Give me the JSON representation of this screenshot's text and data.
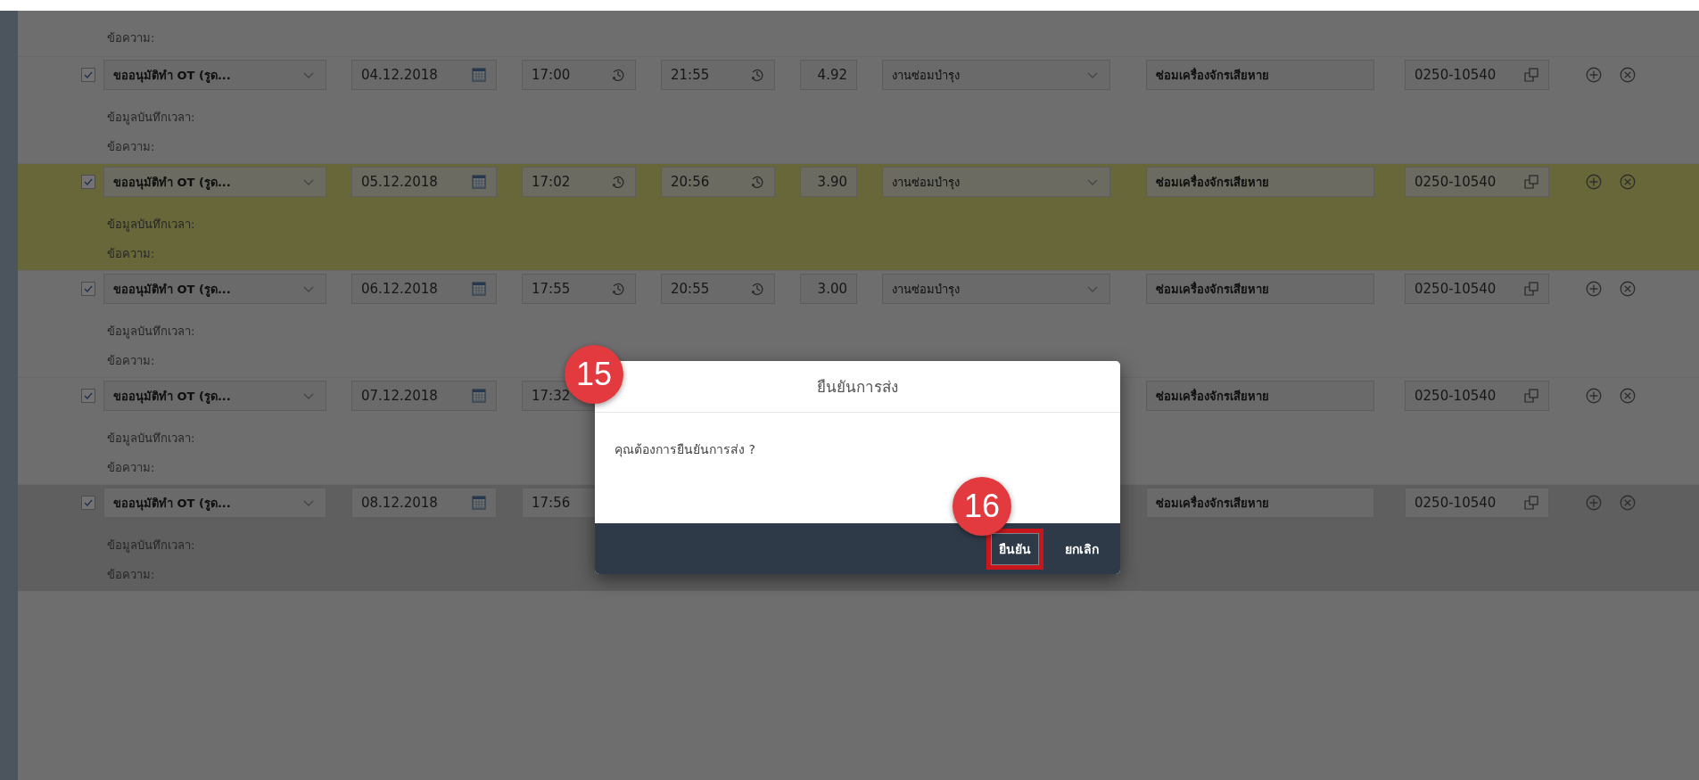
{
  "leading_label": "ข้อความ:",
  "rows": [
    {
      "checked": true,
      "selected": false,
      "hovered": false,
      "type": "ขออนุมัติทำ OT (รูด...",
      "date": "04.12.2018",
      "start": "17:00",
      "end": "21:55",
      "hours": "4.92",
      "category": "งานซ่อมบำรุง",
      "description": "ซ่อมเครื่องจักรเสียหาย",
      "code": "0250-10540",
      "labels": [
        "ข้อมูลบันทึกเวลา:",
        "ข้อความ:"
      ]
    },
    {
      "checked": true,
      "selected": true,
      "hovered": false,
      "type": "ขออนุมัติทำ OT (รูด...",
      "date": "05.12.2018",
      "start": "17:02",
      "end": "20:56",
      "hours": "3.90",
      "category": "งานซ่อมบำรุง",
      "description": "ซ่อมเครื่องจักรเสียหาย",
      "code": "0250-10540",
      "labels": [
        "ข้อมูลบันทึกเวลา:",
        "ข้อความ:"
      ]
    },
    {
      "checked": true,
      "selected": false,
      "hovered": false,
      "type": "ขออนุมัติทำ OT (รูด...",
      "date": "06.12.2018",
      "start": "17:55",
      "end": "20:55",
      "hours": "3.00",
      "category": "งานซ่อมบำรุง",
      "description": "ซ่อมเครื่องจักรเสียหาย",
      "code": "0250-10540",
      "labels": [
        "ข้อมูลบันทึกเวลา:",
        "ข้อความ:"
      ]
    },
    {
      "checked": true,
      "selected": false,
      "hovered": false,
      "type": "ขออนุมัติทำ OT (รูด...",
      "date": "07.12.2018",
      "start": "17:32",
      "description": "ซ่อมเครื่องจักรเสียหาย",
      "code": "0250-10540",
      "labels": [
        "ข้อมูลบันทึกเวลา:",
        "ข้อความ:"
      ]
    },
    {
      "checked": true,
      "selected": false,
      "hovered": true,
      "type": "ขออนุมัติทำ OT (รูด...",
      "date": "08.12.2018",
      "start": "17:56",
      "description": "ซ่อมเครื่องจักรเสียหาย",
      "code": "0250-10540",
      "labels": [
        "ข้อมูลบันทึกเวลา:",
        "ข้อความ:"
      ]
    }
  ],
  "dialog": {
    "title": "ยืนยันการส่ง",
    "message": "คุณต้องการยืนยันการส่ง ?",
    "buttons": [
      {
        "label": "ยืนยัน",
        "kind": "primary",
        "highlighted": true
      },
      {
        "label": "ยกเลิก",
        "kind": "secondary",
        "highlighted": false
      }
    ]
  },
  "step_badges": [
    {
      "kind": "dialog",
      "label": "15"
    },
    {
      "kind": "button",
      "label": "16"
    }
  ]
}
